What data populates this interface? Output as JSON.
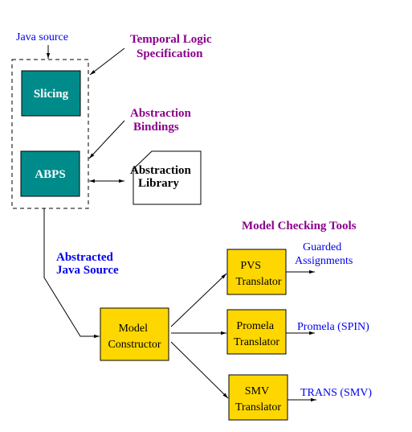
{
  "diagram": {
    "title_labels": {
      "java_source": "Java source",
      "temporal_logic": [
        "Temporal Logic",
        "Specification"
      ],
      "abstraction_bindings": [
        "Abstraction",
        "Bindings"
      ],
      "abstracted_java_source": [
        "Abstracted",
        "Java Source"
      ],
      "model_checking_tools": "Model Checking Tools"
    },
    "nodes": {
      "slicing": "Slicing",
      "abps": "ABPS",
      "abstraction_library": [
        "Abstraction",
        "Library"
      ],
      "model_constructor": [
        "Model",
        "Constructor"
      ],
      "pvs_translator": [
        "PVS",
        "Translator"
      ],
      "promela_translator": [
        "Promela",
        "Translator"
      ],
      "smv_translator": [
        "SMV",
        "Translator"
      ]
    },
    "outputs": {
      "pvs": [
        "Guarded",
        "Assignments"
      ],
      "promela": "Promela (SPIN)",
      "smv": "TRANS (SMV)"
    },
    "colors": {
      "teal": "#008B8B",
      "yellow": "#FFD700",
      "purple": "#8B008B",
      "blue": "#0000EE"
    }
  }
}
